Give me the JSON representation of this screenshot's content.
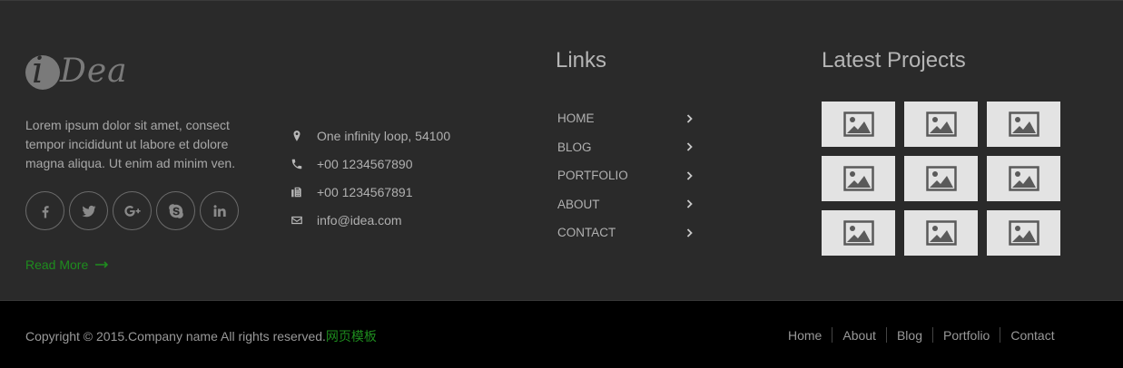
{
  "brand": {
    "logo_letter": "i",
    "logo_rest": "Dea"
  },
  "about": {
    "text": "Lorem ipsum dolor sit amet, consect tempor incididunt ut labore et dolore magna aliqua. Ut enim ad minim ven.",
    "read_more": "Read More"
  },
  "social": [
    {
      "icon": "facebook-icon"
    },
    {
      "icon": "twitter-icon"
    },
    {
      "icon": "google-plus-icon"
    },
    {
      "icon": "skype-icon"
    },
    {
      "icon": "linkedin-icon"
    }
  ],
  "contact": {
    "address": "One infinity loop, 54100",
    "phone": "+00 1234567890",
    "fax": "+00 1234567891",
    "email": "info@idea.com"
  },
  "links": {
    "title": "Links",
    "items": [
      "HOME",
      "BLOG",
      "PORTFOLIO",
      "ABOUT",
      "CONTACT"
    ]
  },
  "projects": {
    "title": "Latest Projects",
    "count": 9
  },
  "bottom": {
    "copyright": "Copyright © 2015.Company name All rights reserved.",
    "copyright_link": "网页模板",
    "nav": [
      "Home",
      "About",
      "Blog",
      "Portfolio",
      "Contact"
    ]
  },
  "colors": {
    "accent": "#1e8c1e",
    "footer_bg": "#2a2a2a",
    "bottom_bg": "#000000"
  }
}
